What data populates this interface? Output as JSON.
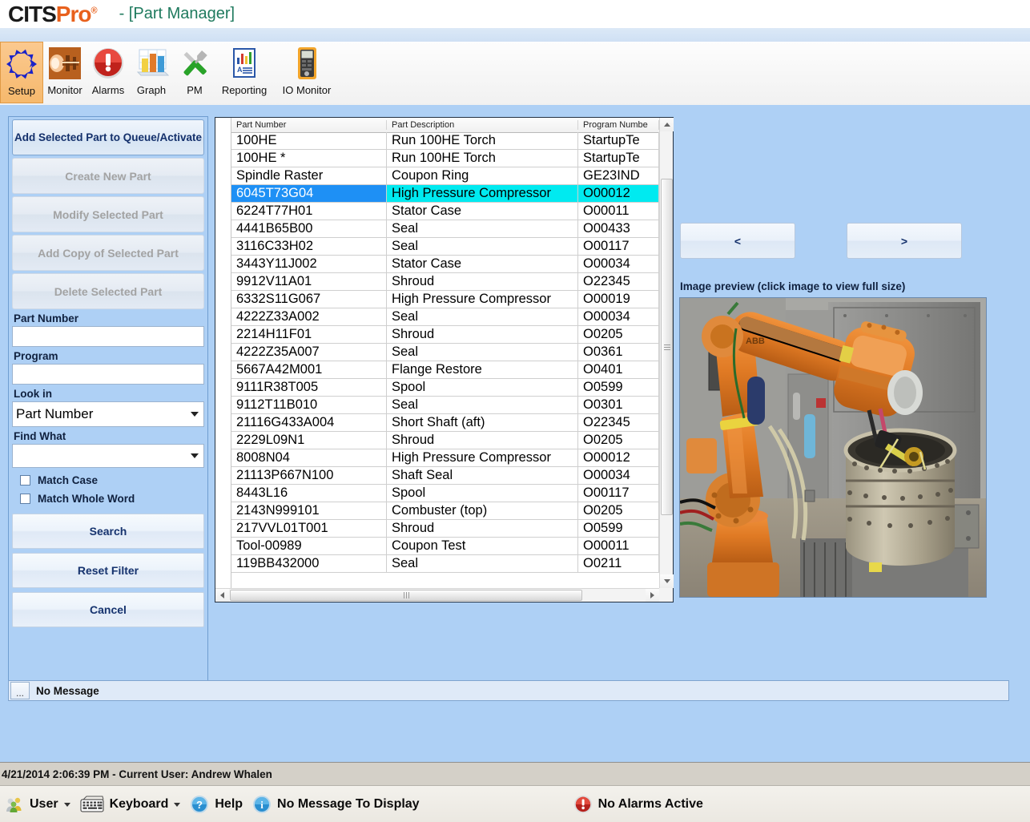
{
  "titlebar": {
    "logo_cits": "CITS",
    "logo_pro": "Pro",
    "logo_reg": "®",
    "window_title": "- [Part Manager]"
  },
  "toolbar": {
    "items": [
      {
        "label": "Setup",
        "icon": "setup-arrows-icon",
        "selected": true
      },
      {
        "label": "Monitor",
        "icon": "monitor-torch-icon",
        "selected": false
      },
      {
        "label": "Alarms",
        "icon": "alarm-exclamation-icon",
        "selected": false
      },
      {
        "label": "Graph",
        "icon": "bar-chart-icon",
        "selected": false
      },
      {
        "label": "PM",
        "icon": "tools-wrench-screwdriver-icon",
        "selected": false
      },
      {
        "label": "Reporting",
        "icon": "report-document-icon",
        "selected": false
      },
      {
        "label": "IO Monitor",
        "icon": "multimeter-icon",
        "selected": false
      }
    ]
  },
  "sidebar": {
    "add_to_queue_label": "Add Selected Part to Queue/Activate",
    "create_new_label": "Create New Part",
    "modify_label": "Modify Selected Part",
    "add_copy_label": "Add Copy of Selected Part",
    "delete_label": "Delete Selected Part",
    "part_number_label": "Part Number",
    "part_number_value": "",
    "program_label": "Program",
    "program_value": "",
    "look_in_label": "Look in",
    "look_in_value": "Part Number",
    "find_what_label": "Find What",
    "find_what_value": "",
    "match_case_label": "Match Case",
    "match_case_checked": false,
    "match_whole_word_label": "Match Whole Word",
    "match_whole_word_checked": false,
    "search_label": "Search",
    "reset_filter_label": "Reset Filter",
    "cancel_label": "Cancel"
  },
  "message_bar": {
    "ellipsis_label": "...",
    "text": "No Message"
  },
  "grid": {
    "columns": [
      "Part Number",
      "Part Description",
      "Program Numbe"
    ],
    "selected_index": 3,
    "rows": [
      [
        "100HE",
        "Run 100HE Torch",
        "StartupTe"
      ],
      [
        "100HE *",
        "Run 100HE Torch",
        "StartupTe"
      ],
      [
        "Spindle Raster",
        "Coupon Ring",
        "GE23IND"
      ],
      [
        "6045T73G04",
        "High Pressure Compressor",
        "O00012"
      ],
      [
        "6224T77H01",
        "Stator Case",
        "O00011"
      ],
      [
        "4441B65B00",
        "Seal",
        "O00433"
      ],
      [
        "3116C33H02",
        "Seal",
        "O00117"
      ],
      [
        "3443Y11J002",
        "Stator Case",
        "O00034"
      ],
      [
        "9912V11A01",
        "Shroud",
        "O22345"
      ],
      [
        "6332S11G067",
        "High Pressure Compressor",
        "O00019"
      ],
      [
        "4222Z33A002",
        "Seal",
        "O00034"
      ],
      [
        "2214H11F01",
        "Shroud",
        "O0205"
      ],
      [
        "4222Z35A007",
        "Seal",
        "O0361"
      ],
      [
        "5667A42M001",
        "Flange Restore",
        "O0401"
      ],
      [
        "9111R38T005",
        "Spool",
        "O0599"
      ],
      [
        "9112T11B010",
        "Seal",
        "O0301"
      ],
      [
        "21116G433A004",
        "Short Shaft (aft)",
        "O22345"
      ],
      [
        "2229L09N1",
        "Shroud",
        "O0205"
      ],
      [
        "8008N04",
        "High Pressure Compressor",
        "O00012"
      ],
      [
        "21113P667N100",
        "Shaft Seal",
        "O00034"
      ],
      [
        "8443L16",
        "Spool",
        "O00117"
      ],
      [
        "2143N999101",
        "Combuster (top)",
        "O0205"
      ],
      [
        "217VVL01T001",
        "Shroud",
        "O0599"
      ],
      [
        "Tool-00989",
        "Coupon Test",
        "O00011"
      ],
      [
        "119BB432000",
        "Seal",
        "O0211"
      ]
    ]
  },
  "right_panel": {
    "prev_label": "<",
    "next_label": ">",
    "preview_caption": "Image preview (click image to view full size)",
    "preview_alt": "orange ABB industrial robot arm welding a turbine engine casing"
  },
  "userbar": {
    "text": "4/21/2014 2:06:39 PM - Current User:  Andrew Whalen"
  },
  "statusbar": {
    "user_label": "User",
    "keyboard_label": "Keyboard",
    "help_label": "Help",
    "message_label": "No Message To Display",
    "alarms_label": "No Alarms Active"
  },
  "colors": {
    "accent_blue": "#aed0f5",
    "selection_blue": "#1e90f5",
    "selection_cyan": "#00eaf0",
    "brand_orange": "#e8601c",
    "title_green": "#1f7a5e"
  }
}
